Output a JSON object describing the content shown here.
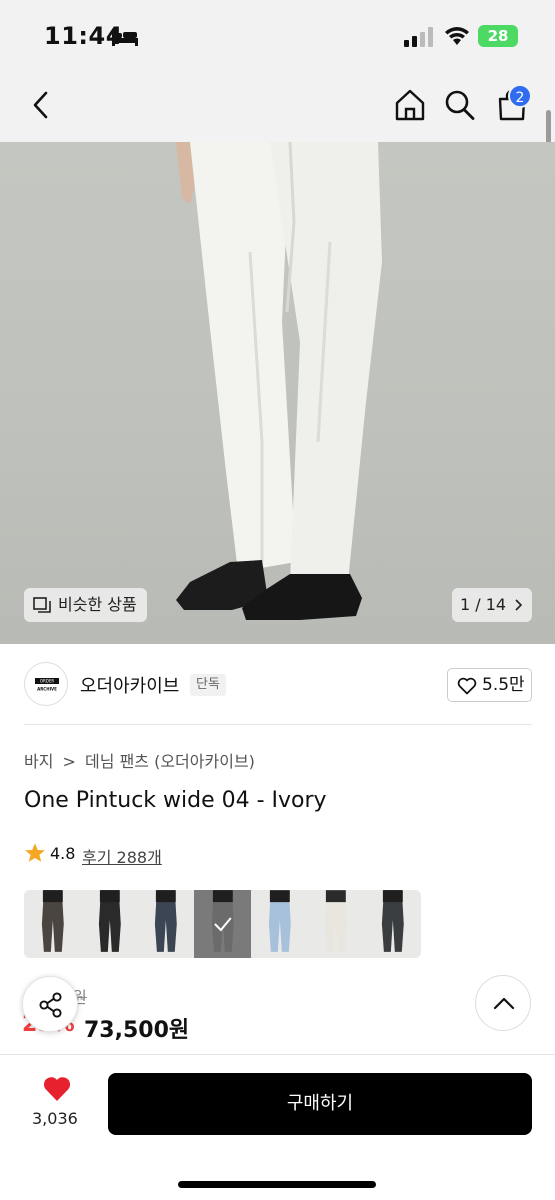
{
  "status_bar": {
    "time": "11:44",
    "battery": "28"
  },
  "nav": {
    "cart_count": "2"
  },
  "hero": {
    "similar_label": "비슷한 상품",
    "image_counter": "1 / 14"
  },
  "seller": {
    "name": "오더아카이브",
    "badge": "단독",
    "likes": "5.5만",
    "logo_line1": "ORDER",
    "logo_line2": "ARCHIVE"
  },
  "breadcrumb": [
    "바지",
    "데님 팬츠 (오더아카이브)"
  ],
  "product": {
    "title": "One Pintuck wide 04 - Ivory",
    "rating": "4.8",
    "reviews": "후기 288개"
  },
  "color_options": [
    "#4a4540",
    "#2a2a2a",
    "#3c4554",
    "#6b6b6b",
    "#a7c0dc",
    "#e8e6df",
    "#3a3d40"
  ],
  "price": {
    "original_partial": "9원",
    "discount_partial": "25%",
    "final": "73,500원"
  },
  "bottom": {
    "wish_count": "3,036",
    "buy_label": "구매하기"
  },
  "colors": {
    "accent": "#2f6cf0",
    "sale": "#f23d3d",
    "heart": "#e8212e",
    "battery": "#4cd964"
  }
}
